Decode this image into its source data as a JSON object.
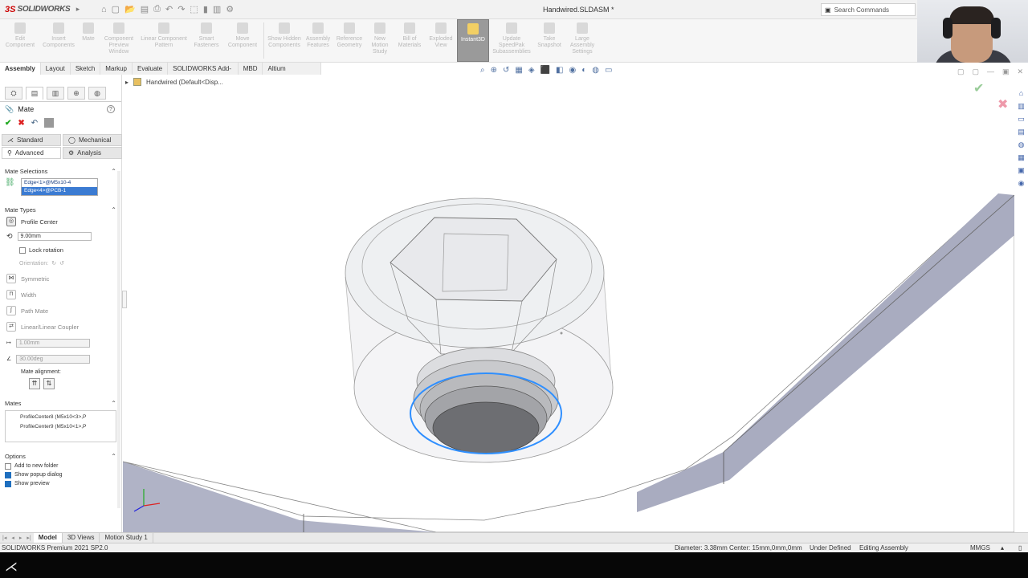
{
  "app": {
    "brand_prefix": "3S",
    "brand": "SOLIDWORKS",
    "doc_title": "Handwired.SLDASM *",
    "search_placeholder": "Search Commands"
  },
  "commands": [
    {
      "label": "Edit Component"
    },
    {
      "label": "Insert Components"
    },
    {
      "label": "Mate"
    },
    {
      "label": "Component Preview Window"
    },
    {
      "label": "Linear Component Pattern"
    },
    {
      "label": "Smart Fasteners"
    },
    {
      "label": "Move Component"
    },
    {
      "label": "Show Hidden Components"
    },
    {
      "label": "Assembly Features"
    },
    {
      "label": "Reference Geometry"
    },
    {
      "label": "New Motion Study"
    },
    {
      "label": "Bill of Materials"
    },
    {
      "label": "Exploded View"
    },
    {
      "label": "Instant3D"
    },
    {
      "label": "Update SpeedPak Subassemblies"
    },
    {
      "label": "Take Snapshot"
    },
    {
      "label": "Large Assembly Settings"
    }
  ],
  "tabs": [
    "Assembly",
    "Layout",
    "Sketch",
    "Markup",
    "Evaluate",
    "SOLIDWORKS Add-Ins",
    "MBD",
    "Altium CoDesigner"
  ],
  "tree": {
    "root": "Handwired  (Default<Disp..."
  },
  "pm": {
    "title": "Mate",
    "tabs": {
      "standard": "Standard",
      "mechanical": "Mechanical",
      "advanced": "Advanced",
      "analysis": "Analysis"
    },
    "mate_selections_hdr": "Mate Selections",
    "selections": [
      "Edge<1>@M5x10-4",
      "Edge<4>@PCB-1"
    ],
    "mate_types_hdr": "Mate Types",
    "profile_center": "Profile Center",
    "offset_value": "9.00mm",
    "lock_rotation": "Lock rotation",
    "orientation": "Orientation:",
    "symmetric": "Symmetric",
    "width": "Width",
    "path_mate": "Path Mate",
    "linear_coupler": "Linear/Linear Coupler",
    "distance_value": "1.00mm",
    "angle_value": "30.00deg",
    "mate_alignment": "Mate alignment:",
    "mates_hdr": "Mates",
    "mates": [
      "ProfileCenter8 (M5x10<3>,P",
      "ProfileCenter9 (M5x10<1>,P"
    ],
    "options_hdr": "Options",
    "options": [
      {
        "label": "Add to new folder",
        "checked": false
      },
      {
        "label": "Show popup dialog",
        "checked": true
      },
      {
        "label": "Show preview",
        "checked": true
      }
    ]
  },
  "bottom_tabs": [
    "Model",
    "3D Views",
    "Motion Study 1"
  ],
  "status": {
    "product": "SOLIDWORKS Premium 2021 SP2.0",
    "measure": "Diameter: 3.38mm  Center: 15mm,0mm,0mm",
    "defined": "Under Defined",
    "mode": "Editing Assembly",
    "units": "MMGS"
  },
  "colors": {
    "selection_blue": "#3b7bd2",
    "edge_highlight": "#2f8fff",
    "board_gray": "#b0b3c6"
  }
}
